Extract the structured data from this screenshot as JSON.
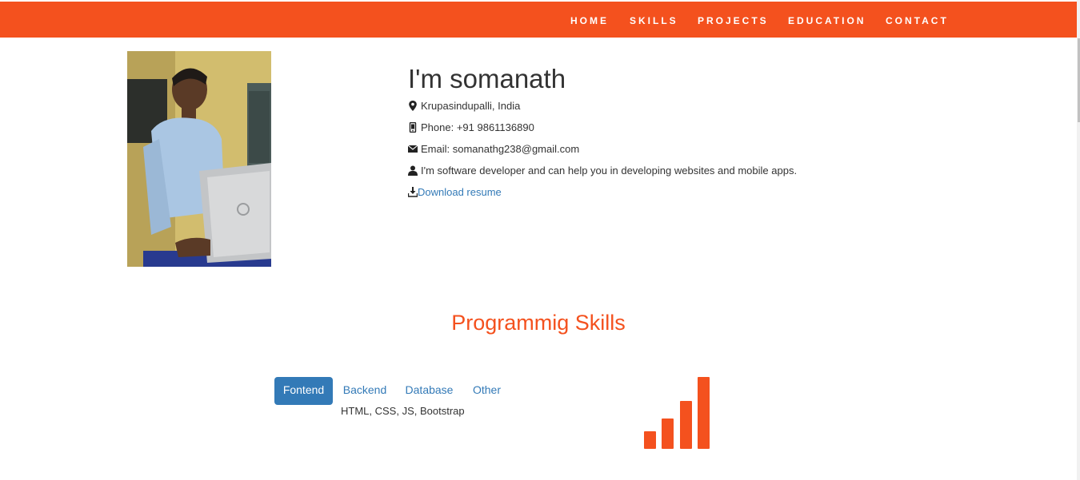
{
  "nav": {
    "items": [
      "HOME",
      "SKILLS",
      "PROJECTS",
      "EDUCATION",
      "CONTACT"
    ]
  },
  "profile": {
    "heading": "I'm somanath",
    "location": "Krupasindupalli, India",
    "phone": "Phone: +91 9861136890",
    "email": "Email: somanathg238@gmail.com",
    "about": "I'm software developer and can help you in developing websites and mobile apps.",
    "resume_link": "Download resume"
  },
  "skills": {
    "title": "Programmig Skills",
    "tabs": [
      "Fontend",
      "Backend",
      "Database",
      "Other"
    ],
    "active_tab": "Fontend",
    "content": "HTML, CSS, JS, Bootstrap"
  },
  "colors": {
    "accent": "#f4511e",
    "link": "#337ab7"
  },
  "icons": [
    "map-marker-icon",
    "phone-icon",
    "envelope-icon",
    "user-icon",
    "download-icon",
    "signal-bars-icon"
  ]
}
